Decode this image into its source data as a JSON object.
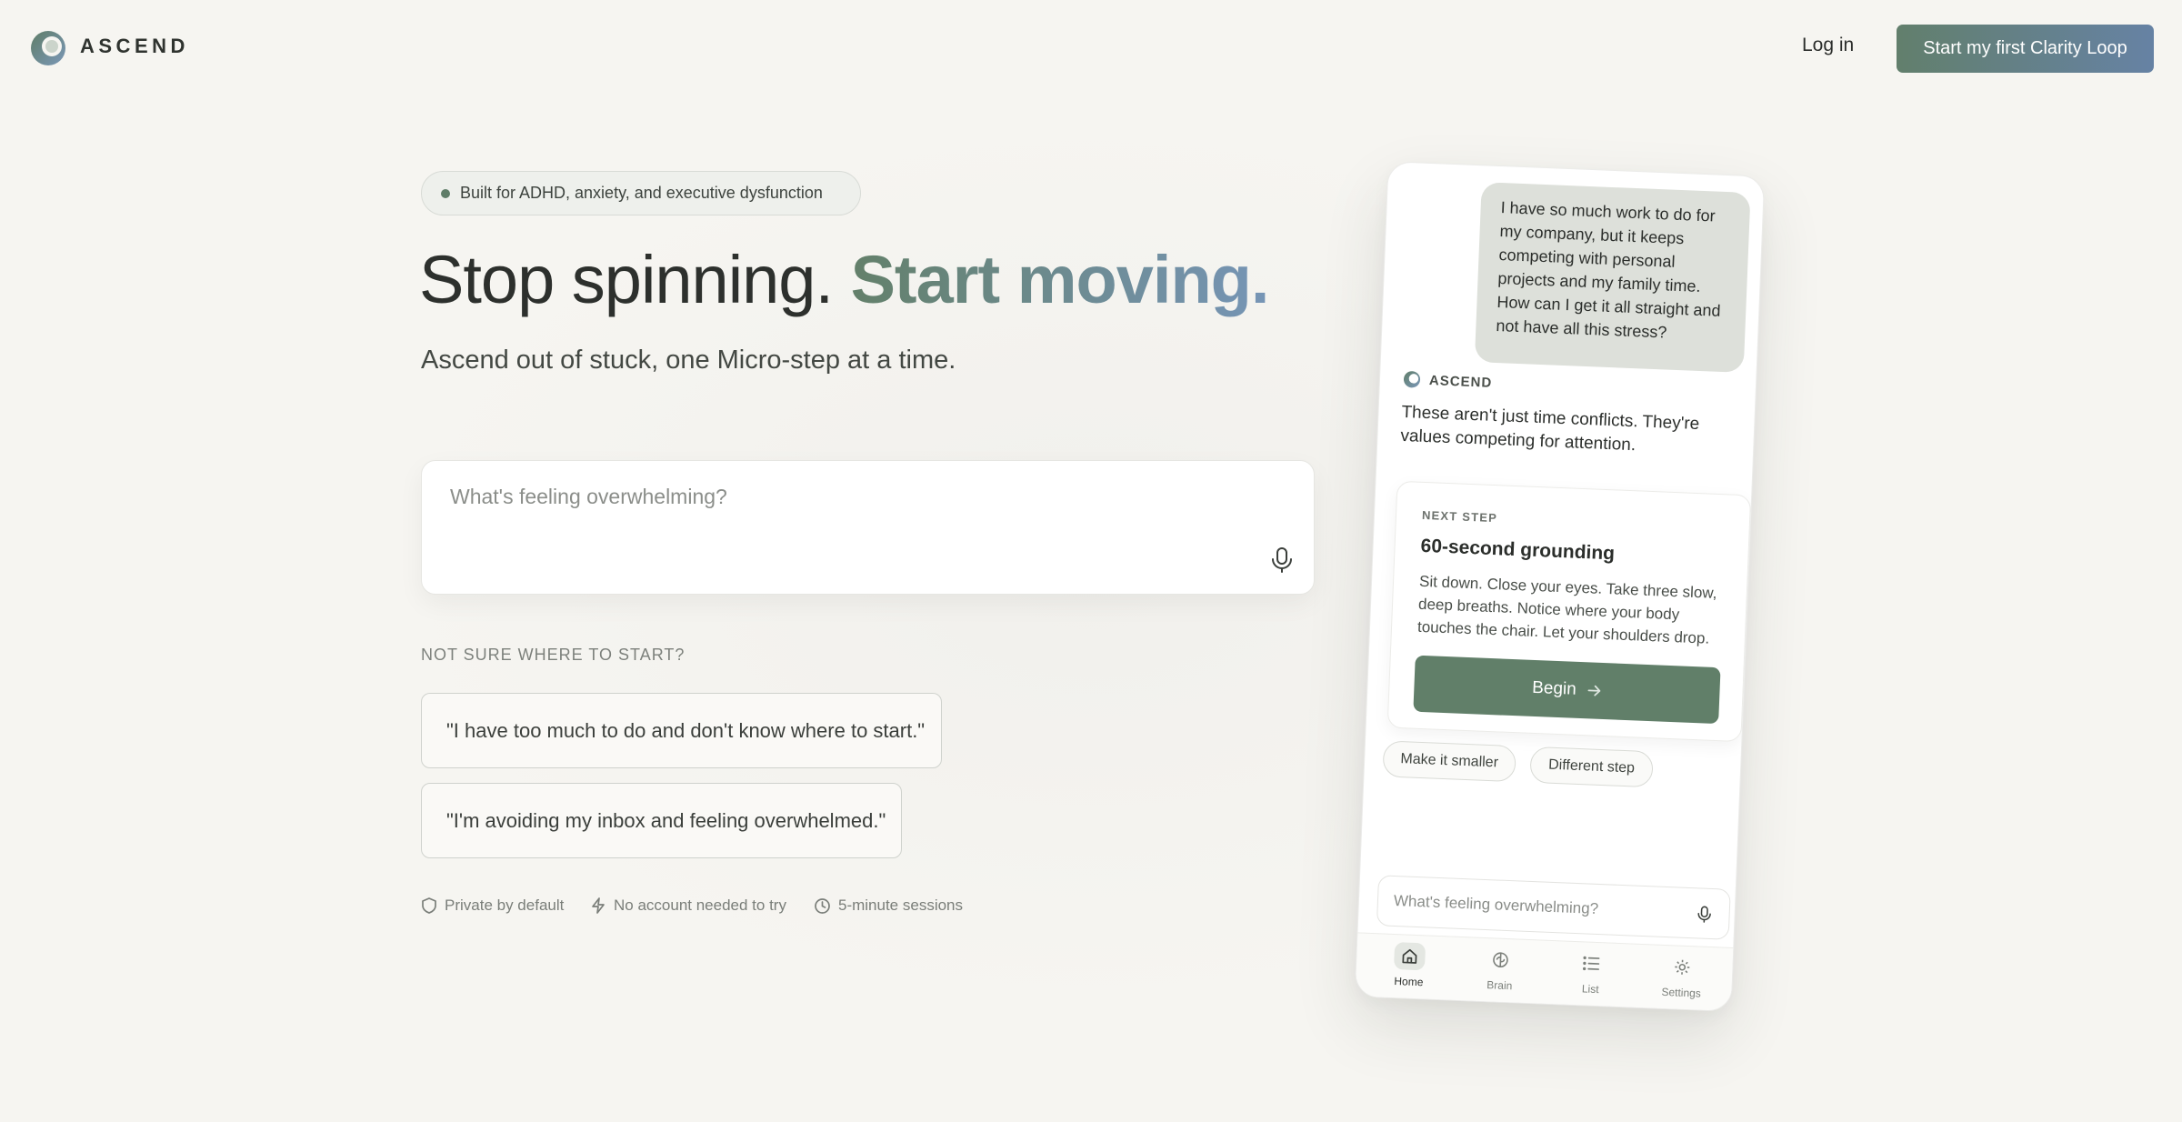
{
  "header": {
    "brand": "ASCEND",
    "login_label": "Log in",
    "cta_label": "Start my first Clarity Loop"
  },
  "hero": {
    "pill_text": "Built for ADHD, anxiety, and executive dysfunction",
    "headline_plain": "Stop spinning. ",
    "headline_accent": "Start moving.",
    "subhead": "Ascend out of stuck, one Micro-step at a time.",
    "input_placeholder": "What's feeling overwhelming?",
    "not_sure_label": "NOT SURE WHERE TO START?",
    "prompts": [
      "\"I have too much to do and don't know where to start.\"",
      "\"I'm avoiding my inbox and feeling overwhelmed.\""
    ],
    "trust": [
      {
        "icon": "shield-icon",
        "label": "Private by default"
      },
      {
        "icon": "bolt-icon",
        "label": "No account needed to try"
      },
      {
        "icon": "clock-icon",
        "label": "5-minute sessions"
      }
    ]
  },
  "phone": {
    "user_message": "I have so much work to do for my company, but it keeps competing with personal projects and my family time. How can I get it all straight and not have all this stress?",
    "ai_name": "ASCEND",
    "ai_message": "These aren't just time conflicts. They're values competing for attention.",
    "step": {
      "label": "NEXT STEP",
      "title": "60-second grounding",
      "body": "Sit down. Close your eyes. Take three slow, deep breaths. Notice where your body touches the chair. Let your shoulders drop.",
      "button_label": "Begin"
    },
    "chips": [
      "Make it smaller",
      "Different step"
    ],
    "input_placeholder": "What's feeling overwhelming?",
    "tabs": [
      {
        "label": "Home",
        "icon": "home-icon",
        "active": true
      },
      {
        "label": "Brain",
        "icon": "brain-icon",
        "active": false
      },
      {
        "label": "List",
        "icon": "list-icon",
        "active": false
      },
      {
        "label": "Settings",
        "icon": "gear-icon",
        "active": false
      }
    ]
  },
  "colors": {
    "accent_green": "#617f69",
    "accent_blue": "#6682a4",
    "background": "#f6f5f1"
  }
}
